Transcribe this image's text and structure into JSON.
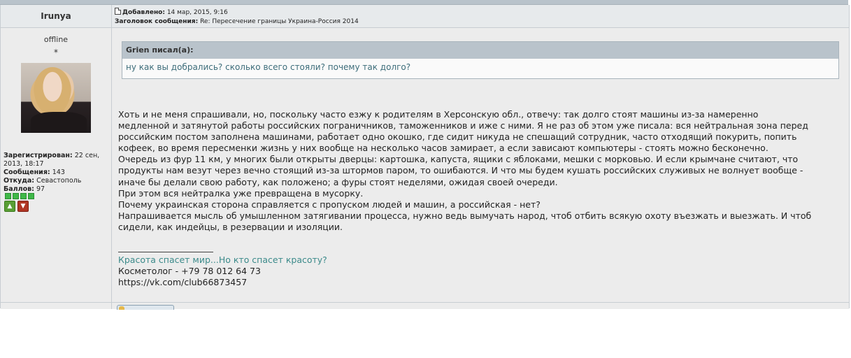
{
  "post": {
    "author": "Irunya",
    "meta": {
      "added_label": "Добавлено:",
      "added_value": "14 мар, 2015, 9:16",
      "subject_label": "Заголовок сообщения:",
      "subject_value": "Re: Пересечение границы Украина-Россия 2014"
    },
    "status": "offline",
    "rank_star": "*",
    "user_info": {
      "registered_label": "Зарегистрирован:",
      "registered_value": "22 сен, 2013, 18:17",
      "posts_label": "Сообщения:",
      "posts_value": "143",
      "from_label": "Откуда:",
      "from_value": "Севастополь",
      "points_label": "Баллов:",
      "points_value": "97"
    },
    "quote": {
      "header": "Grien писал(а):",
      "text": "ну как вы добрались? сколько всего стояли? почему так долго?"
    },
    "body_lines": [
      "Хоть и не меня спрашивали, но, поскольку часто езжу к родителям в Херсонскую обл., отвечу: так долго стоят машины из-за намеренно",
      "медленной и затянутой работы российских пограничников, таможенников и иже с ними. Я не раз об этом уже писала: вся нейтральная зона перед",
      "российским постом заполнена машинами, работает одно окошко, где сидит никуда не спешащий сотрудник, часто отходящий покурить, попить",
      "кофеек, во время пересменки жизнь у них вообще на несколько часов замирает, а если зависают компьютеры - стоять можно бесконечно.",
      "Очередь из фур 11 км, у многих были открыты дверцы: картошка, капуста, ящики с яблоками, мешки с морковью. И если крымчане считают, что",
      "продукты нам везут через вечно стоящий из-за штормов паром, то ошибаются. И что мы будем кушать российских служивых не волнует вообще -",
      "иначе бы делали свою работу, как положено; а фуры стоят неделями, ожидая своей очереди.",
      "При этом вся нейтралка уже превращена в мусорку.",
      "Почему украинская сторона справляется с пропуском людей и машин, а российская - нет?",
      "Напрашивается мысль об умышленном затягивании процесса, нужно ведь вымучать народ, чтоб отбить всякую охоту въезжать и выезжать. И чтоб",
      "сидели, как индейцы, в резервации и изоляции."
    ],
    "signature": {
      "slogan": "Красота спасет мир...Но кто спасет красоту?",
      "line2": "Косметолог - +79 78 012 64 73",
      "line3": "https://vk.com/club66873457"
    },
    "colors": {
      "header_bg": "#e7eaec",
      "quote_header_bg": "#b9c3cb",
      "rating_green": "#3fb848",
      "karma_up": "#5a9e35",
      "karma_down": "#b03524",
      "link_teal": "#3b8a8a"
    }
  }
}
